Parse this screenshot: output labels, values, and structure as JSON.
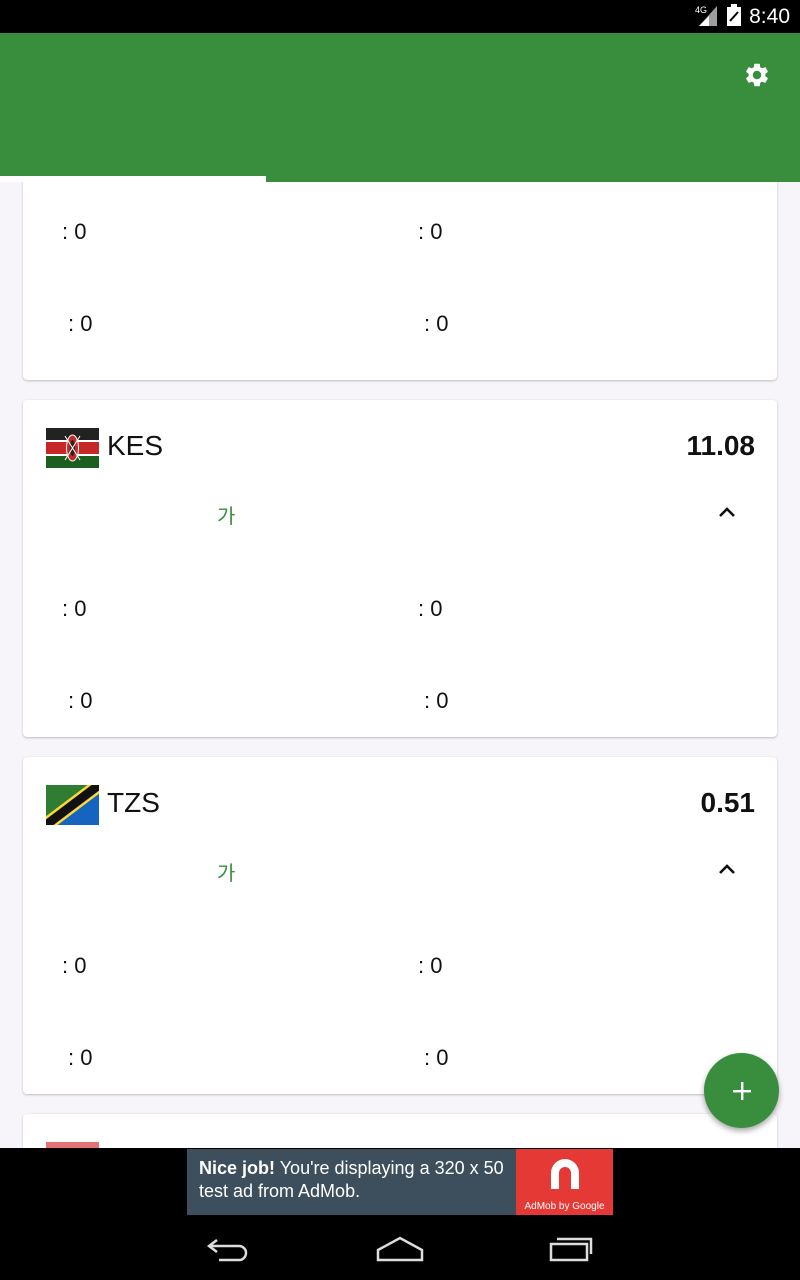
{
  "status_bar": {
    "network": "4G",
    "time": "8:40"
  },
  "app_bar": {
    "settings_icon": "gear-icon"
  },
  "cards": [
    {
      "stats": [
        ": 0",
        ": 0",
        ": 0",
        ": 0"
      ]
    },
    {
      "code": "KES",
      "rate": "11.08",
      "korean_label": "가",
      "flag_icon": "kenya-flag-icon",
      "stats": [
        ": 0",
        ": 0",
        ": 0",
        ": 0"
      ]
    },
    {
      "code": "TZS",
      "rate": "0.51",
      "korean_label": "가",
      "flag_icon": "tanzania-flag-icon",
      "stats": [
        ": 0",
        ": 0",
        ": 0",
        ": 0"
      ]
    }
  ],
  "fab": {
    "icon": "plus-icon"
  },
  "ad": {
    "headline": "Nice job!",
    "body": "You're displaying a 320 x 50 test ad from AdMob.",
    "logo_caption": "AdMob by Google"
  },
  "colors": {
    "primary": "#388E3C",
    "background": "#f7f5f9",
    "ad_background": "#3d4f5c",
    "ad_logo": "#e53935"
  }
}
